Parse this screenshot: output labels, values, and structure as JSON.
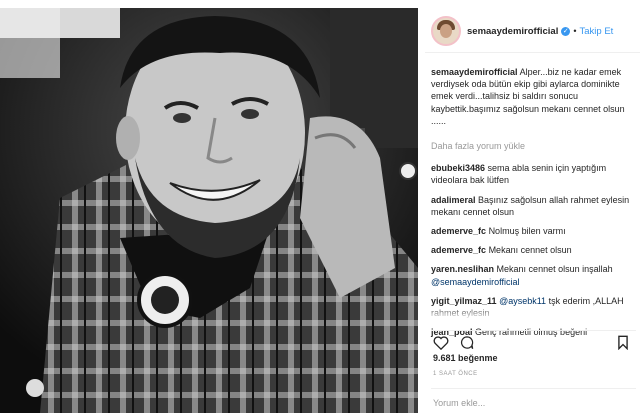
{
  "post": {
    "username": "semaaydemirofficial",
    "follow_label": "Takip Et",
    "caption_user": "semaaydemirofficial",
    "caption_text": "Alper...biz ne kadar emek verdiysek oda bütün ekip gibi aylarca dominikte emek verdi...talihsiz bi saldırı sonucu kaybettik.başımız sağolsun mekanı cennet olsun ......",
    "load_more": "Daha fazla yorum yükle",
    "comments": [
      {
        "user": "ebubeki3486",
        "text": "sema abla senin için yaptığım videolara bak lütfen"
      },
      {
        "user": "adalimeral",
        "text": "Başınız sağolsun allah rahmet eylesin mekanı cennet olsun"
      },
      {
        "user": "ademerve_fc",
        "text": "Nolmuş bilen varmı"
      },
      {
        "user": "ademerve_fc",
        "text": "Mekanı cennet olsun"
      },
      {
        "user": "yaren.neslihan",
        "text": "Mekanı cennet olsun inşallah",
        "mention": "@semaaydemirofficial"
      },
      {
        "user": "yigit_yilmaz_11",
        "mention": "@aysebk11",
        "text": "tşk ederim ,ALLAH rahmet eylesin"
      },
      {
        "user": "jean_poal",
        "text": "Genç rahmetli olmuş beğeni"
      }
    ],
    "likes": "9.681 beğenme",
    "time": "1 SAAT ÖNCE",
    "comment_placeholder": "Yorum ekle..."
  }
}
